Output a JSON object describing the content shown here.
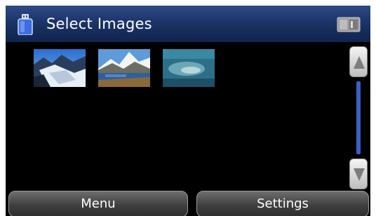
{
  "header": {
    "title": "Select Images",
    "left_icon": "usb-drive-icon",
    "right_icon": "memory-card-icon"
  },
  "thumbnails": [
    {
      "name": "image-thumbnail-glacier"
    },
    {
      "name": "image-thumbnail-mountain-lake"
    },
    {
      "name": "image-thumbnail-water"
    }
  ],
  "scrollbar": {
    "up_icon": "scroll-up-arrow-icon",
    "down_icon": "scroll-down-arrow-icon"
  },
  "buttons": {
    "menu": "Menu",
    "settings": "Settings"
  },
  "colors": {
    "header": "#1c3568",
    "background": "#000000",
    "scroll_track": "#3a61c4"
  }
}
